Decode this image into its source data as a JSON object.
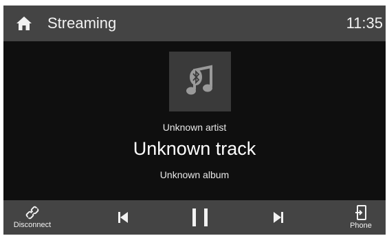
{
  "header": {
    "title": "Streaming",
    "time": "11:35",
    "home_icon": "home-icon"
  },
  "now_playing": {
    "art_icon": "bluetooth-music-icon",
    "artist": "Unknown artist",
    "track": "Unknown track",
    "album": "Unknown album"
  },
  "controls": {
    "disconnect_label": "Disconnect",
    "phone_label": "Phone",
    "prev_icon": "skip-previous-icon",
    "pause_icon": "pause-icon",
    "next_icon": "skip-next-icon",
    "disconnect_icon": "disconnect-link-icon",
    "phone_icon": "phone-icon"
  },
  "colors": {
    "header_bg": "#444444",
    "screen_bg": "#0f0f0f",
    "art_bg": "#3a3a3a",
    "text": "#f2f2f2"
  }
}
